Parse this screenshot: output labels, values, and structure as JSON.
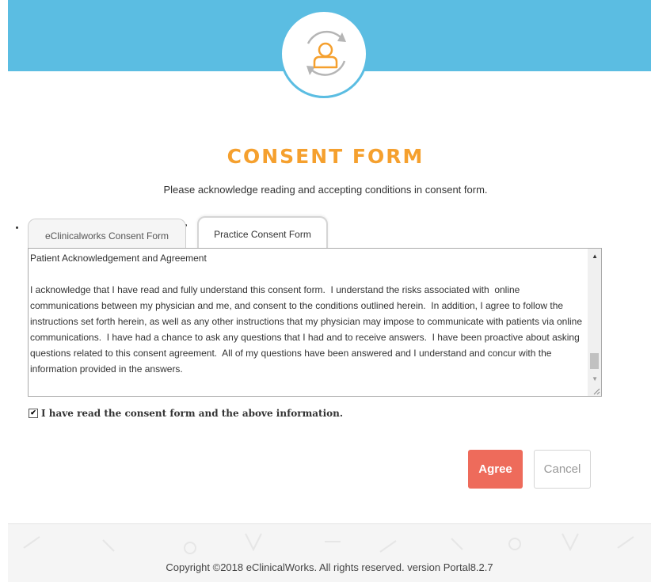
{
  "header": {
    "logo_icon": "user-sync-icon",
    "banner_color": "#5bbde2"
  },
  "title": "CONSENT FORM",
  "subtitle": "Please acknowledge reading and accepting conditions in consent form.",
  "tabs": [
    {
      "label": "eClinicalworks Consent Form",
      "active": false
    },
    {
      "label": "Practice Consent Form",
      "active": true
    }
  ],
  "consent_text": "Patient Acknowledgement and Agreement\n\nI acknowledge that I have read and fully understand this consent form.  I understand the risks associated with  online communications between my physician and me, and consent to the conditions outlined herein.  In addition, I agree to follow the instructions set forth herein, as well as any other instructions that my physician may impose to communicate with patients via online communications.  I have had a chance to ask any questions that I had and to receive answers.  I have been proactive about asking questions related to this consent agreement.  All of my questions have been answered and I understand and concur with the information provided in the answers.",
  "checkbox": {
    "label": "I have read the consent form and the above information.",
    "checked": true
  },
  "buttons": {
    "agree": "Agree",
    "cancel": "Cancel"
  },
  "footer": {
    "copyright": "Copyright ©2018 eClinicalWorks. All rights reserved. version Portal8.2.7"
  },
  "colors": {
    "accent": "#f5a02e",
    "agree": "#ee6b5b",
    "banner": "#5bbde2"
  }
}
